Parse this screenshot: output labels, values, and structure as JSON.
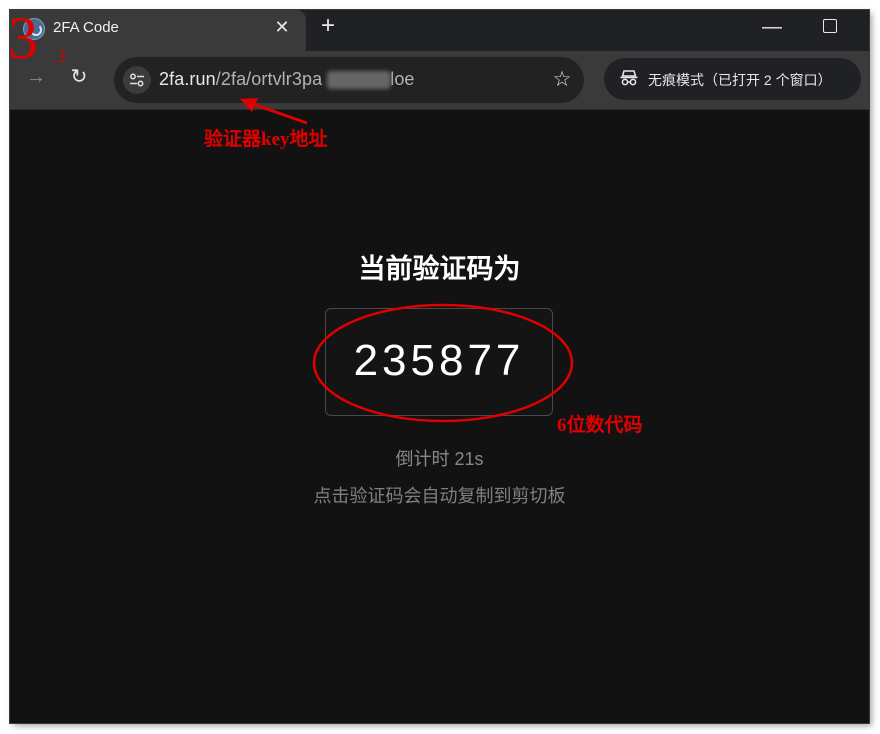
{
  "tab": {
    "favicon": "2fa-favicon-icon",
    "title": "2FA Code",
    "close_icon": "close-icon"
  },
  "tabstrip": {
    "new_tab_icon": "plus-icon",
    "minimize_icon": "minimize-icon",
    "maximize_icon": "maximize-icon"
  },
  "toolbar": {
    "forward_icon": "arrow-right-icon",
    "reload_icon": "reload-icon",
    "site_settings_icon": "tune-icon",
    "url_host": "2fa.run",
    "url_path_visible_start": "/2fa/ortvlr3pa",
    "url_path_visible_end": "loe",
    "bookmark_icon": "star-icon",
    "incognito_icon": "incognito-icon",
    "incognito_label": "无痕模式（已打开 2 个窗口）"
  },
  "page": {
    "heading": "当前验证码为",
    "code": "235877",
    "countdown": "倒计时 21s",
    "hint": "点击验证码会自动复制到剪切板"
  },
  "annotations": {
    "step_number": "3",
    "step_suffix": ".3",
    "key_note": "验证器key地址",
    "code_note": "6位数代码",
    "color": "#e00000"
  },
  "colors": {
    "page_background": "#121212",
    "toolbar": "#3a3a3a",
    "tabstrip": "#202124",
    "code_text": "#ffffff",
    "muted_text": "#888888"
  }
}
